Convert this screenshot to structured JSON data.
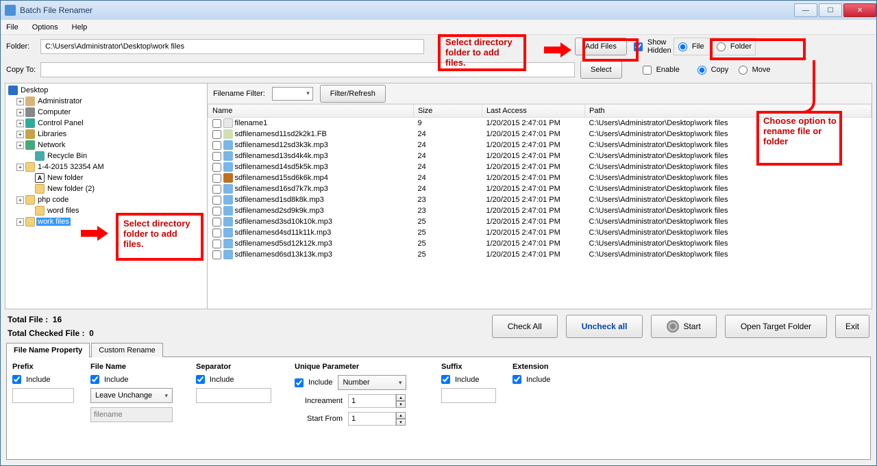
{
  "window": {
    "title": "Batch File Renamer"
  },
  "menu": {
    "file": "File",
    "options": "Options",
    "help": "Help"
  },
  "toolbar": {
    "folder_label": "Folder:",
    "folder_value": "C:\\Users\\Administrator\\Desktop\\work files",
    "add_files": "Add Files",
    "show_hidden": "Show Hidden",
    "mode_file": "File",
    "mode_folder": "Folder",
    "copyto_label": "Copy To:",
    "copyto_value": "",
    "select": "Select",
    "enable": "Enable",
    "copy": "Copy",
    "move": "Move"
  },
  "tree": {
    "root": "Desktop",
    "items": [
      {
        "label": "Administrator",
        "icon": "user-ico",
        "exp": "+",
        "ind": "ind1"
      },
      {
        "label": "Computer",
        "icon": "computer-ico",
        "exp": "+",
        "ind": "ind1"
      },
      {
        "label": "Control Panel",
        "icon": "panel-ico",
        "exp": "+",
        "ind": "ind1"
      },
      {
        "label": "Libraries",
        "icon": "lib-ico",
        "exp": "+",
        "ind": "ind1"
      },
      {
        "label": "Network",
        "icon": "net-ico",
        "exp": "+",
        "ind": "ind1"
      },
      {
        "label": "Recycle Bin",
        "icon": "recycle-ico",
        "exp": "",
        "ind": "ind2"
      },
      {
        "label": "1-4-2015 32354 AM",
        "icon": "folder-ico",
        "exp": "+",
        "ind": "ind1"
      },
      {
        "label": "New folder",
        "icon": "a-ico",
        "exp": "",
        "ind": "ind2",
        "glyph": "A"
      },
      {
        "label": "New folder (2)",
        "icon": "folder-ico",
        "exp": "",
        "ind": "ind2"
      },
      {
        "label": "php code",
        "icon": "folder-ico",
        "exp": "+",
        "ind": "ind1"
      },
      {
        "label": "word files",
        "icon": "folder-ico",
        "exp": "",
        "ind": "ind2"
      },
      {
        "label": "work files",
        "icon": "folder-ico",
        "exp": "+",
        "ind": "ind1",
        "sel": true
      }
    ]
  },
  "filterrow": {
    "label": "Filename Filter:",
    "btn": "Filter/Refresh"
  },
  "table": {
    "headers": {
      "name": "Name",
      "size": "Size",
      "last": "Last Access",
      "path": "Path"
    },
    "rows": [
      {
        "name": "filename1",
        "size": "9",
        "last": "1/20/2015 2:47:01 PM",
        "path": "C:\\Users\\Administrator\\Desktop\\work files",
        "ico": "txt"
      },
      {
        "name": "sdfilenamesd11sd2k2k1.FB",
        "size": "24",
        "last": "1/20/2015 2:47:01 PM",
        "path": "C:\\Users\\Administrator\\Desktop\\work files",
        "ico": "fb"
      },
      {
        "name": "sdfilenamesd12sd3k3k.mp3",
        "size": "24",
        "last": "1/20/2015 2:47:01 PM",
        "path": "C:\\Users\\Administrator\\Desktop\\work files",
        "ico": "mp3"
      },
      {
        "name": "sdfilenamesd13sd4k4k.mp3",
        "size": "24",
        "last": "1/20/2015 2:47:01 PM",
        "path": "C:\\Users\\Administrator\\Desktop\\work files",
        "ico": "mp3"
      },
      {
        "name": "sdfilenamesd14sd5k5k.mp3",
        "size": "24",
        "last": "1/20/2015 2:47:01 PM",
        "path": "C:\\Users\\Administrator\\Desktop\\work files",
        "ico": "mp3"
      },
      {
        "name": "sdfilenamesd15sd6k6k.mp4",
        "size": "24",
        "last": "1/20/2015 2:47:01 PM",
        "path": "C:\\Users\\Administrator\\Desktop\\work files",
        "ico": "mp4"
      },
      {
        "name": "sdfilenamesd16sd7k7k.mp3",
        "size": "24",
        "last": "1/20/2015 2:47:01 PM",
        "path": "C:\\Users\\Administrator\\Desktop\\work files",
        "ico": "mp3"
      },
      {
        "name": "sdfilenamesd1sd8k8k.mp3",
        "size": "23",
        "last": "1/20/2015 2:47:01 PM",
        "path": "C:\\Users\\Administrator\\Desktop\\work files",
        "ico": "mp3"
      },
      {
        "name": "sdfilenamesd2sd9k9k.mp3",
        "size": "23",
        "last": "1/20/2015 2:47:01 PM",
        "path": "C:\\Users\\Administrator\\Desktop\\work files",
        "ico": "mp3"
      },
      {
        "name": "sdfilenamesd3sd10k10k.mp3",
        "size": "25",
        "last": "1/20/2015 2:47:01 PM",
        "path": "C:\\Users\\Administrator\\Desktop\\work files",
        "ico": "mp3"
      },
      {
        "name": "sdfilenamesd4sd11k11k.mp3",
        "size": "25",
        "last": "1/20/2015 2:47:01 PM",
        "path": "C:\\Users\\Administrator\\Desktop\\work files",
        "ico": "mp3"
      },
      {
        "name": "sdfilenamesd5sd12k12k.mp3",
        "size": "25",
        "last": "1/20/2015 2:47:01 PM",
        "path": "C:\\Users\\Administrator\\Desktop\\work files",
        "ico": "mp3"
      },
      {
        "name": "sdfilenamesd6sd13k13k.mp3",
        "size": "25",
        "last": "1/20/2015 2:47:01 PM",
        "path": "C:\\Users\\Administrator\\Desktop\\work files",
        "ico": "mp3"
      }
    ]
  },
  "stats": {
    "total_label": "Total File :",
    "total_val": "16",
    "checked_label": "Total Checked File :",
    "checked_val": "0",
    "check_all": "Check All",
    "uncheck_all": "Uncheck all",
    "start": "Start",
    "open_target": "Open Target Folder",
    "exit": "Exit"
  },
  "tabs": {
    "property": "File Name Property",
    "custom": "Custom Rename"
  },
  "panel": {
    "prefix": {
      "title": "Prefix",
      "include": "Include"
    },
    "filename": {
      "title": "File Name",
      "include": "Include",
      "option": "Leave Unchange",
      "placeholder": "filename"
    },
    "separator": {
      "title": "Separator",
      "include": "Include"
    },
    "unique": {
      "title": "Unique Parameter",
      "include": "Include",
      "type": "Number",
      "incr_label": "Increament",
      "incr": "1",
      "start_label": "Start From",
      "start": "1"
    },
    "suffix": {
      "title": "Suffix",
      "include": "Include"
    },
    "extension": {
      "title": "Extension",
      "include": "Include"
    }
  },
  "annotations": {
    "addfiles": "Select directory folder to add files.",
    "tree": "Select directory folder to add files.",
    "mode": "Choose option to rename file or folder"
  }
}
